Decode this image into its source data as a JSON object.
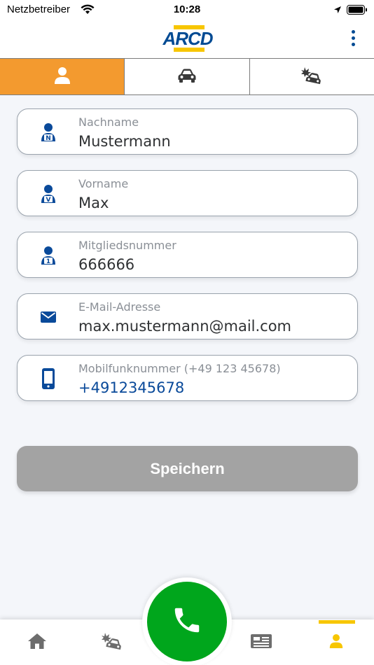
{
  "status_bar": {
    "carrier": "Netzbetreiber",
    "time": "10:28"
  },
  "header": {
    "logo_text": "ARCD",
    "menu_icon": "more-vertical-icon"
  },
  "tabs": [
    {
      "icon": "person-icon",
      "active": true
    },
    {
      "icon": "car-icon",
      "active": false
    },
    {
      "icon": "car-accident-icon",
      "active": false
    }
  ],
  "form": {
    "fields": [
      {
        "label": "Nachname",
        "value": "Mustermann",
        "icon": "person-n-icon"
      },
      {
        "label": "Vorname",
        "value": "Max",
        "icon": "person-v-icon"
      },
      {
        "label": "Mitgliedsnummer",
        "value": "666666",
        "icon": "person-1-icon"
      },
      {
        "label": "E-Mail-Adresse",
        "value": "max.mustermann@mail.com",
        "icon": "mail-icon"
      },
      {
        "label": "Mobilfunknummer (+49 123 45678)",
        "value": "+4912345678",
        "icon": "mobile-phone-icon"
      }
    ],
    "save_label": "Speichern"
  },
  "bottom_nav": {
    "items": [
      "home-icon",
      "car-accident-icon",
      "phone-icon",
      "news-icon",
      "person-icon"
    ],
    "active": "person-icon"
  },
  "colors": {
    "brand_blue": "#004a93",
    "brand_yellow": "#f7c600",
    "active_tab": "#f39a2f",
    "call_green": "#00a61c",
    "disabled_button": "#a3a3a3"
  }
}
